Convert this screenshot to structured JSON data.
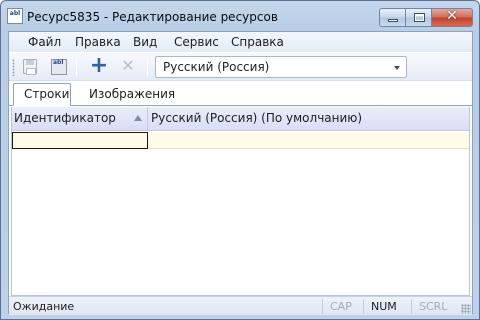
{
  "window": {
    "title": "Ресурс5835 - Редактирование ресурсов",
    "icon": "resource-app-icon",
    "app_icon_text": "abl",
    "controls": [
      "minimize-icon",
      "maximize-icon",
      "close-icon"
    ],
    "close_glyph": "✕"
  },
  "menu": {
    "items": [
      "Файл",
      "Правка",
      "Вид",
      "Сервис",
      "Справка"
    ]
  },
  "toolbar": {
    "buttons": [
      "save-icon",
      "save-as-icon",
      "add-icon",
      "delete-icon"
    ],
    "save_as_text": "abl",
    "add_glyph": "+",
    "delete_glyph": "✕",
    "language": "Русский (Россия)"
  },
  "tabs": {
    "items": [
      "Строки",
      "Изображения"
    ],
    "active": "Строки"
  },
  "grid": {
    "columns": [
      "Идентификатор",
      "Русский (Россия) (По умолчанию)"
    ],
    "sorted_column": "Идентификатор",
    "rows": [
      {
        "id": "",
        "value": ""
      }
    ]
  },
  "status": {
    "text": "Ожидание",
    "cap": "CAP",
    "num": "NUM",
    "scrl": "SCRL",
    "active_keys": [
      "NUM"
    ]
  },
  "colors": {
    "title_gradient": "#c5d7ec",
    "new_row": "#fefbe6",
    "header": "#e9edfb",
    "close_button": "#c0432a"
  }
}
